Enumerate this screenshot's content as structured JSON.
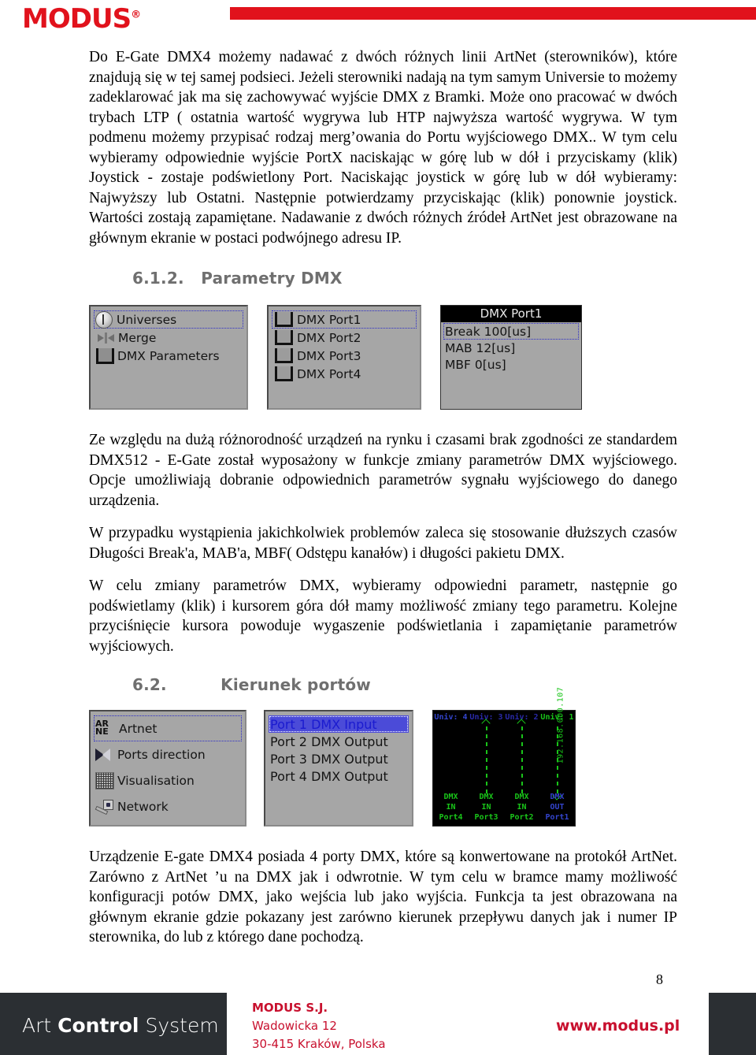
{
  "header": {
    "logo_text": "MODUS",
    "logo_reg": "®",
    "bar_color": "#e1121c"
  },
  "paragraphs": {
    "p1": "Do E-Gate DMX4 możemy nadawać z dwóch różnych linii ArtNet (sterowników), które znajdują się w tej samej podsieci. Jeżeli sterowniki nadają na tym samym Universie to możemy zadeklarować jak ma się zachowywać wyjście DMX z Bramki. Może ono pracować w dwóch trybach LTP ( ostatnia wartość wygrywa lub HTP najwyższa wartość wygrywa. W tym podmenu możemy przypisać rodzaj merg’owania do Portu wyjściowego DMX.. W tym celu wybieramy odpowiednie wyjście PortX naciskając w górę lub w dół i przyciskamy (klik) Joystick - zostaje podświetlony Port. Naciskając joystick w górę lub w dół wybieramy: Najwyższy lub Ostatni. Następnie potwierdzamy przyciskając (klik) ponownie joystick. Wartości zostają zapamiętane. Nadawanie z dwóch różnych źródeł ArtNet jest obrazowane na głównym ekranie w postaci podwójnego adresu IP.",
    "p2": "Ze względu na dużą różnorodność urządzeń na rynku i czasami brak zgodności ze standardem DMX512 - E-Gate został wyposażony w funkcje zmiany parametrów DMX wyjściowego. Opcje umożliwiają dobranie odpowiednich parametrów sygnału wyjściowego do danego urządzenia.",
    "p3": "W przypadku wystąpienia jakichkolwiek problemów zaleca się stosowanie dłuższych czasów Długości Break'a, MAB'a, MBF( Odstępu kanałów) i długości pakietu DMX.",
    "p4": "W celu zmiany parametrów DMX, wybieramy odpowiedni parametr, następnie go podświetlamy (klik) i kursorem góra dół mamy możliwość zmiany tego parametru. Kolejne przyciśnięcie kursora powoduje wygaszenie podświetlania i zapamiętanie parametrów wyjściowych.",
    "p5": "Urządzenie E-gate DMX4 posiada 4 porty DMX, które są konwertowane na protokół ArtNet. Zarówno z ArtNet ’u na DMX jak i odwrotnie. W tym celu w bramce mamy możliwość konfiguracji potów DMX, jako wejścia lub jako wyjścia. Funkcja ta jest obrazowana na głównym ekranie gdzie pokazany jest zarówno kierunek przepływu danych jak i numer IP sterownika, do lub z którego dane pochodzą."
  },
  "headings": {
    "h1_num": "6.1.2.",
    "h1_text": "Parametry DMX",
    "h2_num": "6.2.",
    "h2_text": "Kierunek portów"
  },
  "figure_dmx": {
    "menu": {
      "items": [
        {
          "label": "Universes",
          "icon": "universe-icon",
          "selected": true
        },
        {
          "label": "Merge",
          "icon": "merge-arrows-icon",
          "selected": false
        },
        {
          "label": "DMX Parameters",
          "icon": "dmx-connector-icon",
          "selected": false
        }
      ]
    },
    "ports": {
      "items": [
        {
          "label": "DMX Port1",
          "selected": true
        },
        {
          "label": "DMX Port2",
          "selected": false
        },
        {
          "label": "DMX Port3",
          "selected": false
        },
        {
          "label": "DMX Port4",
          "selected": false
        }
      ]
    },
    "params": {
      "title": "DMX Port1",
      "items": [
        {
          "label": "Break 100[us]",
          "selected": true
        },
        {
          "label": "MAB 12[us]",
          "selected": false
        },
        {
          "label": "MBF 0[us]",
          "selected": false
        }
      ]
    }
  },
  "figure_dir": {
    "menu": {
      "items": [
        {
          "label": "Artnet",
          "icon": "artnet-logo-icon",
          "selected": true
        },
        {
          "label": "Ports direction",
          "icon": "direction-arrows-icon",
          "selected": false
        },
        {
          "label": "Visualisation",
          "icon": "grid-icon",
          "selected": false
        },
        {
          "label": "Network",
          "icon": "key-icon",
          "selected": false
        }
      ]
    },
    "ports": {
      "items": [
        {
          "label": "Port 1 DMX Input",
          "selected": true
        },
        {
          "label": "Port 2 DMX Output",
          "selected": false
        },
        {
          "label": "Port 3 DMX Output",
          "selected": false
        },
        {
          "label": "Port 4 DMX Output",
          "selected": false
        }
      ]
    },
    "screen": {
      "ip": "192.168.000.107",
      "columns": [
        {
          "univ": "Univ: 4",
          "dmx": "DMX",
          "dir": "IN",
          "port": "Port4",
          "color": "#3344cc",
          "flow": "none"
        },
        {
          "univ": "Univ: 3",
          "dmx": "DMX",
          "dir": "IN",
          "port": "Port3",
          "color": "#19c419",
          "flow": "up"
        },
        {
          "univ": "Univ: 2",
          "dmx": "DMX",
          "dir": "IN",
          "port": "Port2",
          "color": "#19c419",
          "flow": "up"
        },
        {
          "univ": "Univ: 1",
          "dmx": "DMX",
          "dir": "OUT",
          "port": "Port1",
          "color": "#3344cc",
          "flow": "down"
        }
      ]
    }
  },
  "footer": {
    "brand_pre": "Art ",
    "brand_mid": "Control",
    "brand_post": " System",
    "company": "MODUS S.J.",
    "street": "Wadowicka 12",
    "city": "30-415 Kraków, Polska",
    "url": "www.modus.pl",
    "page": "8"
  }
}
